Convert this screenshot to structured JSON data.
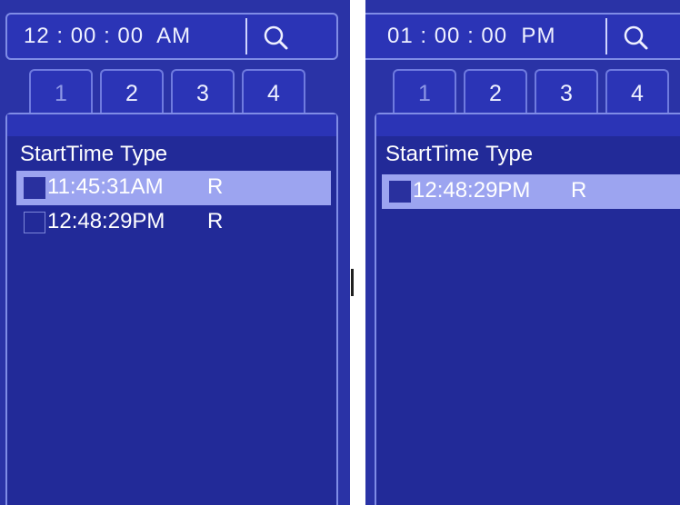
{
  "left": {
    "time": "12 : 00 : 00  AM",
    "tabs": [
      "1",
      "2",
      "3",
      "4"
    ],
    "header": {
      "start_time": "StartTime",
      "type": "Type"
    },
    "records": [
      {
        "time": "11:45:31AM",
        "type": "R"
      },
      {
        "time": "12:48:29PM",
        "type": "R"
      }
    ]
  },
  "right": {
    "time": "01 : 00 : 00  PM",
    "tabs": [
      "1",
      "2",
      "3",
      "4"
    ],
    "header": {
      "start_time": "StartTime",
      "type": "Type"
    },
    "records": [
      {
        "time": "12:48:29PM",
        "type": "R"
      }
    ]
  },
  "icons": {
    "search": "search-icon"
  },
  "colors": {
    "panel_bg": "#2a33a6",
    "list_bg": "#222a98",
    "selected_row": "#9ca4f0",
    "border": "#7f8ce6",
    "active_tab_text": "#8d97e6"
  }
}
